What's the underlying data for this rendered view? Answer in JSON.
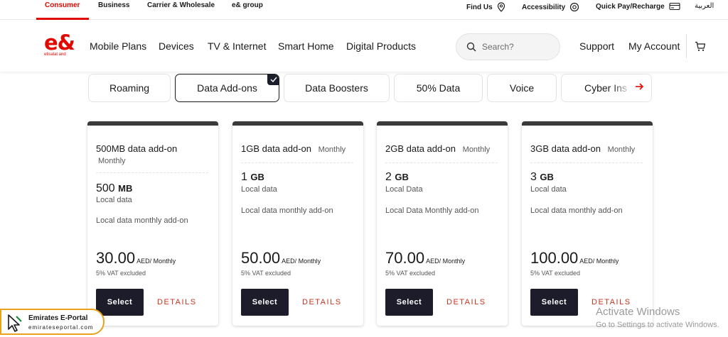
{
  "topbar": {
    "segments": [
      "Consumer",
      "Business",
      "Carrier & Wholesale",
      "e& group"
    ],
    "utilities": [
      "Find Us",
      "Accessibility",
      "Quick Pay/Recharge",
      "العربية"
    ]
  },
  "nav": {
    "logo_mark": "e&",
    "logo_sub": "etisalat and",
    "links": [
      "Mobile Plans",
      "Devices",
      "TV & Internet",
      "Smart Home",
      "Digital Products"
    ],
    "search_placeholder": "Search?",
    "support": "Support",
    "account": "My Account"
  },
  "chips": [
    {
      "label": "Roaming",
      "active": false
    },
    {
      "label": "Data Add-ons",
      "active": true
    },
    {
      "label": "Data Boosters",
      "active": false
    },
    {
      "label": "50% Data",
      "active": false
    },
    {
      "label": "Voice",
      "active": false
    },
    {
      "label": "Cyber Ins",
      "active": false
    }
  ],
  "cards": [
    {
      "name": "500MB data add-on",
      "freq": "Monthly",
      "qty_num": "500",
      "qty_unit": "MB",
      "qty_label": "Local data",
      "desc": "Local data monthly add-on",
      "price": "30.00",
      "price_unit": "AED/ Monthly",
      "vat": "5% VAT excluded",
      "select": "Select",
      "details": "DETAILS"
    },
    {
      "name": "1GB data add-on",
      "freq": "Monthly",
      "qty_num": "1",
      "qty_unit": "GB",
      "qty_label": "Local data",
      "desc": "Local data monthly add-on",
      "price": "50.00",
      "price_unit": "AED/ Monthly",
      "vat": "5% VAT excluded",
      "select": "Select",
      "details": "DETAILS"
    },
    {
      "name": "2GB data add-on",
      "freq": "Monthly",
      "qty_num": "2",
      "qty_unit": "GB",
      "qty_label": "Local Data",
      "desc": "Local Data Monthly add-on",
      "price": "70.00",
      "price_unit": "AED/ Monthly",
      "vat": "5% VAT excluded",
      "select": "Select",
      "details": "DETAILS"
    },
    {
      "name": "3GB data add-on",
      "freq": "Monthly",
      "qty_num": "3",
      "qty_unit": "GB",
      "qty_label": "Local data",
      "desc": "Local data monthly add-on",
      "price": "100.00",
      "price_unit": "AED/ Monthly",
      "vat": "5% VAT excluded",
      "select": "Select",
      "details": "DETAILS"
    }
  ],
  "portal": {
    "title": "Emirates E-Portal",
    "url": "emirateseportal.com"
  },
  "windows": {
    "line1": "Activate Windows",
    "line2": "Go to Settings to activate Windows."
  },
  "colors": {
    "brand_red": "#e00800",
    "button_dark": "#1c1c2b",
    "details_red": "#c8341e"
  }
}
